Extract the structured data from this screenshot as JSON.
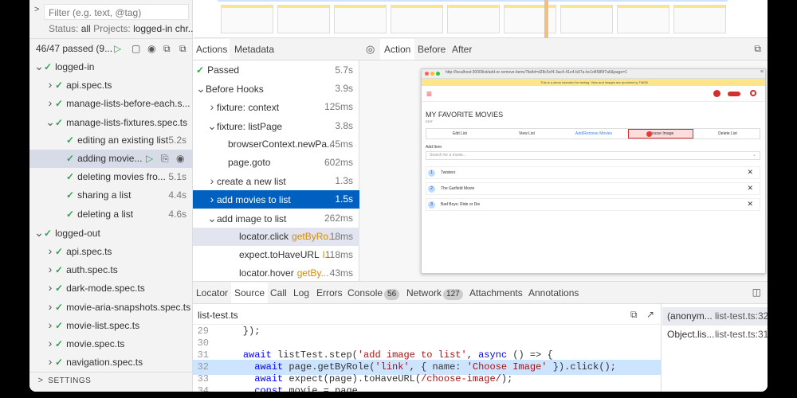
{
  "sidebar": {
    "filter_placeholder": "Filter (e.g. text, @tag)",
    "status_label": "Status:",
    "status_value": "all",
    "projects_label": "Projects:",
    "projects_value": "logged-in chr...",
    "summary": "46/47 passed (9...",
    "tree": [
      {
        "label": "logged-in",
        "depth": 0,
        "chev": "v"
      },
      {
        "label": "api.spec.ts",
        "depth": 1,
        "chev": ">"
      },
      {
        "label": "manage-lists-before-each.s...",
        "depth": 1,
        "chev": ">"
      },
      {
        "label": "manage-lists-fixtures.spec.ts",
        "depth": 1,
        "chev": "v"
      },
      {
        "label": "editing an existing list",
        "depth": 2,
        "time": "5.2s"
      },
      {
        "label": "adding movie...",
        "depth": 2,
        "selected": true
      },
      {
        "label": "deleting movies fro...",
        "depth": 2,
        "time": "5.1s"
      },
      {
        "label": "sharing a list",
        "depth": 2,
        "time": "4.4s"
      },
      {
        "label": "deleting a list",
        "depth": 2,
        "time": "4.6s"
      },
      {
        "label": "logged-out",
        "depth": 0,
        "chev": "v"
      },
      {
        "label": "api.spec.ts",
        "depth": 1,
        "chev": ">"
      },
      {
        "label": "auth.spec.ts",
        "depth": 1,
        "chev": ">"
      },
      {
        "label": "dark-mode.spec.ts",
        "depth": 1,
        "chev": ">"
      },
      {
        "label": "movie-aria-snapshots.spec.ts",
        "depth": 1,
        "chev": ">"
      },
      {
        "label": "movie-list.spec.ts",
        "depth": 1,
        "chev": ">"
      },
      {
        "label": "movie.spec.ts",
        "depth": 1,
        "chev": ">"
      },
      {
        "label": "navigation.spec.ts",
        "depth": 1,
        "chev": ">"
      }
    ],
    "settings": "SETTINGS"
  },
  "actions_panel": {
    "tabs": [
      "Actions",
      "Metadata"
    ],
    "rows": [
      {
        "label": "Passed",
        "time": "5.7s",
        "indent": 0,
        "check": true
      },
      {
        "label": "Before Hooks",
        "time": "3.9s",
        "indent": 0,
        "chev": "v"
      },
      {
        "label": "fixture: context",
        "time": "125ms",
        "indent": 1,
        "chev": ">"
      },
      {
        "label": "fixture: listPage",
        "time": "3.8s",
        "indent": 1,
        "chev": "v"
      },
      {
        "label": "browserContext.newPa...",
        "time": "45ms",
        "indent": 2
      },
      {
        "label": "page.goto",
        "time": "602ms",
        "indent": 2
      },
      {
        "label": "create a new list",
        "time": "1.3s",
        "indent": 1,
        "chev": ">"
      },
      {
        "label": "add movies to list",
        "time": "1.5s",
        "indent": 1,
        "chev": ">",
        "selected": true
      },
      {
        "label": "add image to list",
        "time": "262ms",
        "indent": 1,
        "chev": "v"
      },
      {
        "label": "locator.click",
        "arg": "getByRo...",
        "time": "18ms",
        "indent": 3,
        "hover": true
      },
      {
        "label": "expect.toHaveURL",
        "arg": "l...",
        "time": "118ms",
        "indent": 3
      },
      {
        "label": "locator.hover",
        "arg": "getBy...",
        "time": "43ms",
        "indent": 3
      }
    ]
  },
  "snapshot_panel": {
    "tabs": [
      "Action",
      "Before",
      "After"
    ],
    "url": "http://localhost:3000/list/add-or-remove-items?listId=d28c5cf4-3ac4-41e4-b07a-bc1d4585f7a5&page=1",
    "banner": "This is a demo intended for testing. View and images are provided by TMDB",
    "page_title": "MY FAVORITE MOVIES",
    "page_subtitle": "EDIT",
    "nav": [
      "Edit List",
      "View List",
      "Add/Remove Movies",
      "Choose Image",
      "Delete List"
    ],
    "add_item_label": "Add Item",
    "search_placeholder": "Search for a movie...",
    "movies": [
      {
        "num": "1",
        "title": "Twisters"
      },
      {
        "num": "2",
        "title": "The Garfield Movie"
      },
      {
        "num": "3",
        "title": "Bad Boys: Ride or Die"
      }
    ]
  },
  "bottom_tabs": {
    "tabs": [
      "Locator",
      "Source",
      "Call",
      "Log",
      "Errors",
      "Console",
      "Network",
      "Attachments",
      "Annotations"
    ],
    "console_count": "56",
    "network_count": "127"
  },
  "source": {
    "filename": "list-test.ts",
    "lines": [
      {
        "no": "29",
        "text": "    });"
      },
      {
        "no": "30",
        "text": ""
      },
      {
        "no": "31",
        "text": "    await listTest.step('add image to list', async () => {"
      },
      {
        "no": "32",
        "text": "      await page.getByRole('link', { name: 'Choose Image' }).click();",
        "highlight": true
      },
      {
        "no": "33",
        "text": "      await expect(page).toHaveURL(/choose-image/);"
      },
      {
        "no": "34",
        "text": "      const movie = page"
      }
    ]
  },
  "stack": [
    {
      "fn": "(anonym...",
      "loc": "list-test.ts:32"
    },
    {
      "fn": "Object.lis...",
      "loc": "list-test.ts:31"
    }
  ]
}
